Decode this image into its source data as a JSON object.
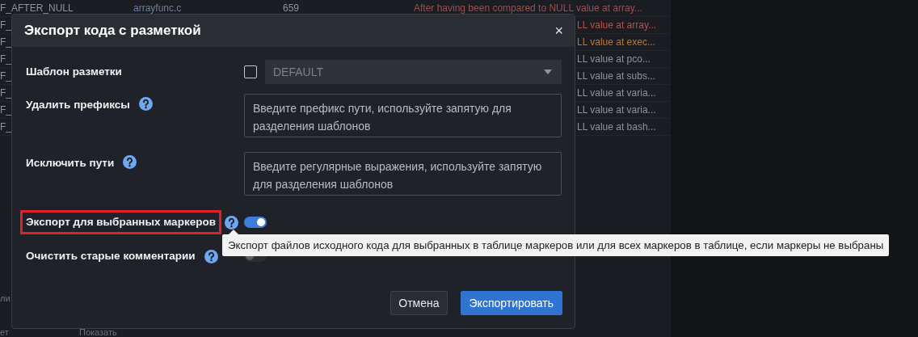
{
  "background": {
    "top_row": {
      "column_1": "F_AFTER_NULL",
      "column_2": "arrayfunc.c",
      "column_3": "659",
      "column_4": "After having been compared to NULL value at array..."
    },
    "rows": [
      {
        "column_1": "F_",
        "column_4": "LL value at array...",
        "color": "#b8504a"
      },
      {
        "column_1": "F_",
        "column_4": "LL value at exec...",
        "color": "#b7793a"
      },
      {
        "column_1": "F_",
        "column_4": "LL value at pco...",
        "color": "#8f939a"
      },
      {
        "column_1": "F_",
        "column_4": "LL value at subs...",
        "color": "#8f939a"
      },
      {
        "column_1": "F_",
        "column_4": "LL value at varia...",
        "color": "#8f939a"
      },
      {
        "column_1": "F_",
        "column_4": "LL value at varia...",
        "color": "#8f939a"
      },
      {
        "column_1": "F_",
        "column_4": "LL value at bash...",
        "color": "#8f939a"
      }
    ],
    "fragments": [
      "ли",
      "ет",
      "Показать"
    ]
  },
  "dialog": {
    "title": "Экспорт кода с разметкой",
    "close": "×",
    "fields": [
      {
        "kind": "select",
        "label": "Шаблон разметки",
        "help": false,
        "checked": false,
        "value": "DEFAULT",
        "disabled": true
      },
      {
        "kind": "textarea",
        "label": "Удалить префиксы",
        "help": true,
        "placeholder": "Введите префикс пути, используйте запятую для разделения шаблонов"
      },
      {
        "kind": "textarea",
        "label": "Исключить пути",
        "help": true,
        "placeholder": "Введите регулярные выражения, используйте запятую для разделения шаблонов"
      },
      {
        "kind": "toggle",
        "label": "Экспорт для выбранных маркеров",
        "help": true,
        "on": true,
        "highlighted": true,
        "tooltip": "Экспорт файлов исходного кода для выбранных в таблице маркеров или для всех маркеров в таблице, если маркеры не выбраны"
      },
      {
        "kind": "toggle",
        "label": "Очистить старые комментарии",
        "help": true,
        "on": false,
        "highlighted": false
      }
    ],
    "buttons": [
      {
        "label": "Отмена",
        "primary": false
      },
      {
        "label": "Экспортировать",
        "primary": true
      }
    ]
  }
}
